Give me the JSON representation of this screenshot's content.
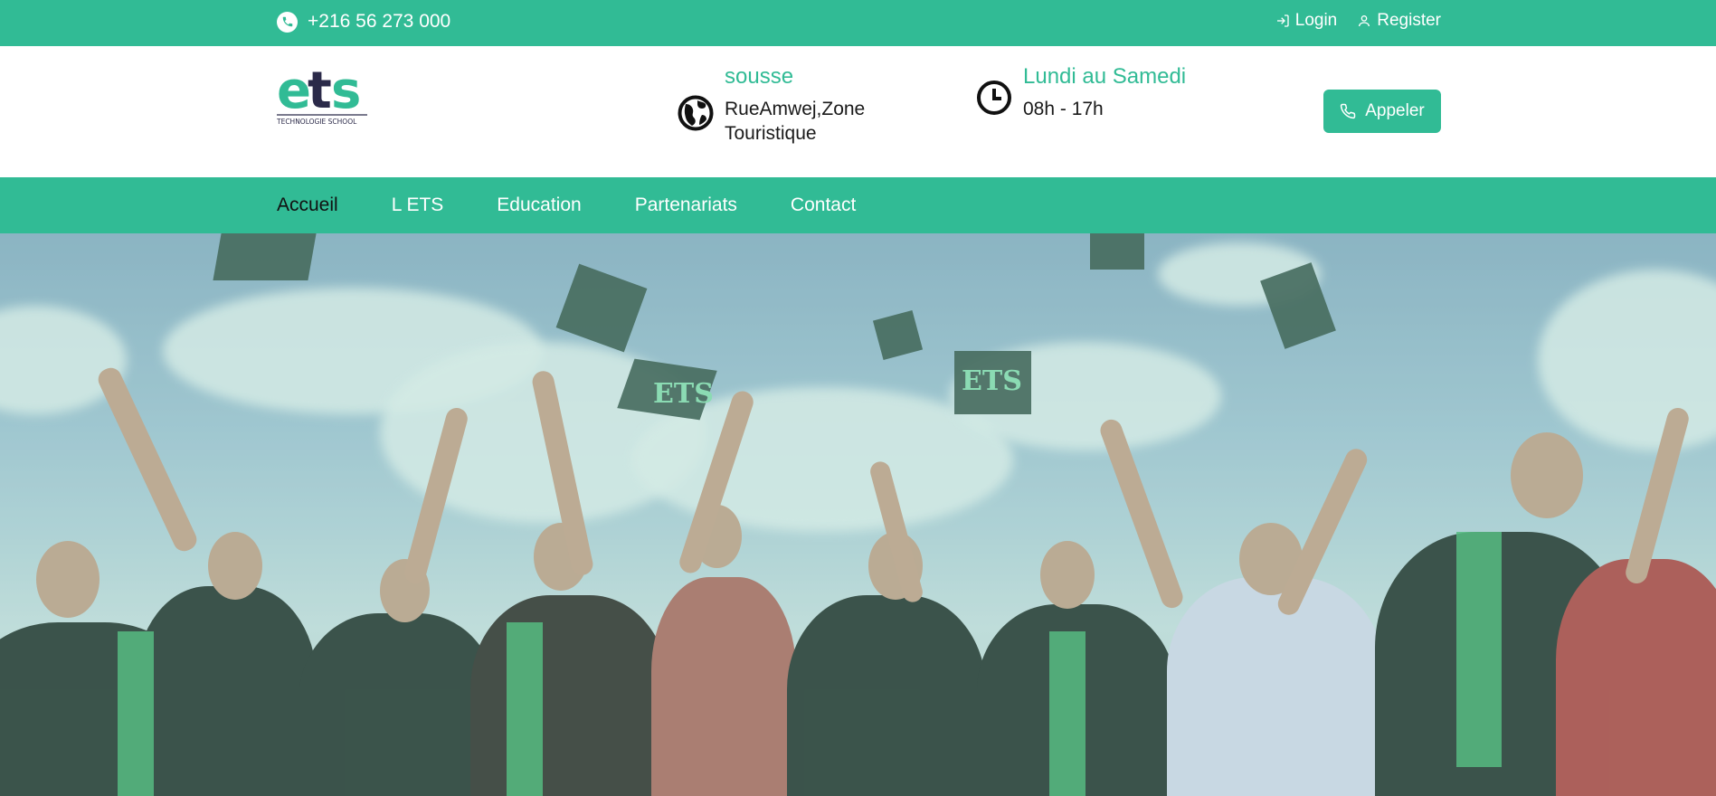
{
  "topbar": {
    "phone": "+216 56 273 000",
    "login_label": "Login",
    "register_label": "Register"
  },
  "header": {
    "logo_text": "ets",
    "logo_subtitle": "TECHNOLOGIE SCHOOL",
    "location_title": "sousse",
    "location_line1": "RueAmwej,Zone",
    "location_line2": "Touristique",
    "hours_title": "Lundi au Samedi",
    "hours_text": "08h - 17h",
    "call_label": "Appeler"
  },
  "nav": {
    "items": [
      "Accueil",
      "L ETS",
      "Education",
      "Partenariats",
      "Contact"
    ],
    "active_index": 0
  },
  "hero": {
    "cap_text_1": "ETS",
    "cap_text_2": "ETS"
  },
  "colors": {
    "brand": "#31bb95",
    "logo_dark": "#2b2a49"
  }
}
